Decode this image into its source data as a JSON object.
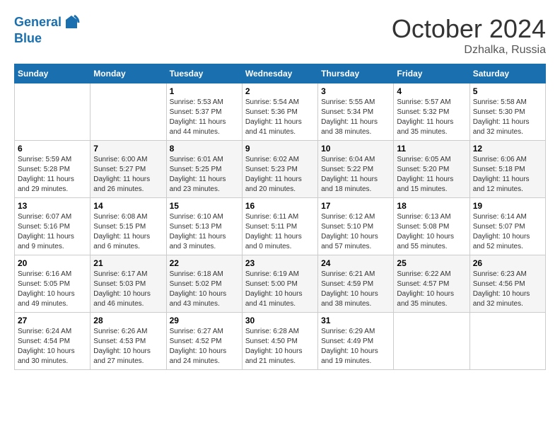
{
  "logo": {
    "line1": "General",
    "line2": "Blue"
  },
  "title": "October 2024",
  "location": "Dzhalka, Russia",
  "days_of_week": [
    "Sunday",
    "Monday",
    "Tuesday",
    "Wednesday",
    "Thursday",
    "Friday",
    "Saturday"
  ],
  "weeks": [
    [
      {
        "day": "",
        "sunrise": "",
        "sunset": "",
        "daylight": ""
      },
      {
        "day": "",
        "sunrise": "",
        "sunset": "",
        "daylight": ""
      },
      {
        "day": "1",
        "sunrise": "Sunrise: 5:53 AM",
        "sunset": "Sunset: 5:37 PM",
        "daylight": "Daylight: 11 hours and 44 minutes."
      },
      {
        "day": "2",
        "sunrise": "Sunrise: 5:54 AM",
        "sunset": "Sunset: 5:36 PM",
        "daylight": "Daylight: 11 hours and 41 minutes."
      },
      {
        "day": "3",
        "sunrise": "Sunrise: 5:55 AM",
        "sunset": "Sunset: 5:34 PM",
        "daylight": "Daylight: 11 hours and 38 minutes."
      },
      {
        "day": "4",
        "sunrise": "Sunrise: 5:57 AM",
        "sunset": "Sunset: 5:32 PM",
        "daylight": "Daylight: 11 hours and 35 minutes."
      },
      {
        "day": "5",
        "sunrise": "Sunrise: 5:58 AM",
        "sunset": "Sunset: 5:30 PM",
        "daylight": "Daylight: 11 hours and 32 minutes."
      }
    ],
    [
      {
        "day": "6",
        "sunrise": "Sunrise: 5:59 AM",
        "sunset": "Sunset: 5:28 PM",
        "daylight": "Daylight: 11 hours and 29 minutes."
      },
      {
        "day": "7",
        "sunrise": "Sunrise: 6:00 AM",
        "sunset": "Sunset: 5:27 PM",
        "daylight": "Daylight: 11 hours and 26 minutes."
      },
      {
        "day": "8",
        "sunrise": "Sunrise: 6:01 AM",
        "sunset": "Sunset: 5:25 PM",
        "daylight": "Daylight: 11 hours and 23 minutes."
      },
      {
        "day": "9",
        "sunrise": "Sunrise: 6:02 AM",
        "sunset": "Sunset: 5:23 PM",
        "daylight": "Daylight: 11 hours and 20 minutes."
      },
      {
        "day": "10",
        "sunrise": "Sunrise: 6:04 AM",
        "sunset": "Sunset: 5:22 PM",
        "daylight": "Daylight: 11 hours and 18 minutes."
      },
      {
        "day": "11",
        "sunrise": "Sunrise: 6:05 AM",
        "sunset": "Sunset: 5:20 PM",
        "daylight": "Daylight: 11 hours and 15 minutes."
      },
      {
        "day": "12",
        "sunrise": "Sunrise: 6:06 AM",
        "sunset": "Sunset: 5:18 PM",
        "daylight": "Daylight: 11 hours and 12 minutes."
      }
    ],
    [
      {
        "day": "13",
        "sunrise": "Sunrise: 6:07 AM",
        "sunset": "Sunset: 5:16 PM",
        "daylight": "Daylight: 11 hours and 9 minutes."
      },
      {
        "day": "14",
        "sunrise": "Sunrise: 6:08 AM",
        "sunset": "Sunset: 5:15 PM",
        "daylight": "Daylight: 11 hours and 6 minutes."
      },
      {
        "day": "15",
        "sunrise": "Sunrise: 6:10 AM",
        "sunset": "Sunset: 5:13 PM",
        "daylight": "Daylight: 11 hours and 3 minutes."
      },
      {
        "day": "16",
        "sunrise": "Sunrise: 6:11 AM",
        "sunset": "Sunset: 5:11 PM",
        "daylight": "Daylight: 11 hours and 0 minutes."
      },
      {
        "day": "17",
        "sunrise": "Sunrise: 6:12 AM",
        "sunset": "Sunset: 5:10 PM",
        "daylight": "Daylight: 10 hours and 57 minutes."
      },
      {
        "day": "18",
        "sunrise": "Sunrise: 6:13 AM",
        "sunset": "Sunset: 5:08 PM",
        "daylight": "Daylight: 10 hours and 55 minutes."
      },
      {
        "day": "19",
        "sunrise": "Sunrise: 6:14 AM",
        "sunset": "Sunset: 5:07 PM",
        "daylight": "Daylight: 10 hours and 52 minutes."
      }
    ],
    [
      {
        "day": "20",
        "sunrise": "Sunrise: 6:16 AM",
        "sunset": "Sunset: 5:05 PM",
        "daylight": "Daylight: 10 hours and 49 minutes."
      },
      {
        "day": "21",
        "sunrise": "Sunrise: 6:17 AM",
        "sunset": "Sunset: 5:03 PM",
        "daylight": "Daylight: 10 hours and 46 minutes."
      },
      {
        "day": "22",
        "sunrise": "Sunrise: 6:18 AM",
        "sunset": "Sunset: 5:02 PM",
        "daylight": "Daylight: 10 hours and 43 minutes."
      },
      {
        "day": "23",
        "sunrise": "Sunrise: 6:19 AM",
        "sunset": "Sunset: 5:00 PM",
        "daylight": "Daylight: 10 hours and 41 minutes."
      },
      {
        "day": "24",
        "sunrise": "Sunrise: 6:21 AM",
        "sunset": "Sunset: 4:59 PM",
        "daylight": "Daylight: 10 hours and 38 minutes."
      },
      {
        "day": "25",
        "sunrise": "Sunrise: 6:22 AM",
        "sunset": "Sunset: 4:57 PM",
        "daylight": "Daylight: 10 hours and 35 minutes."
      },
      {
        "day": "26",
        "sunrise": "Sunrise: 6:23 AM",
        "sunset": "Sunset: 4:56 PM",
        "daylight": "Daylight: 10 hours and 32 minutes."
      }
    ],
    [
      {
        "day": "27",
        "sunrise": "Sunrise: 6:24 AM",
        "sunset": "Sunset: 4:54 PM",
        "daylight": "Daylight: 10 hours and 30 minutes."
      },
      {
        "day": "28",
        "sunrise": "Sunrise: 6:26 AM",
        "sunset": "Sunset: 4:53 PM",
        "daylight": "Daylight: 10 hours and 27 minutes."
      },
      {
        "day": "29",
        "sunrise": "Sunrise: 6:27 AM",
        "sunset": "Sunset: 4:52 PM",
        "daylight": "Daylight: 10 hours and 24 minutes."
      },
      {
        "day": "30",
        "sunrise": "Sunrise: 6:28 AM",
        "sunset": "Sunset: 4:50 PM",
        "daylight": "Daylight: 10 hours and 21 minutes."
      },
      {
        "day": "31",
        "sunrise": "Sunrise: 6:29 AM",
        "sunset": "Sunset: 4:49 PM",
        "daylight": "Daylight: 10 hours and 19 minutes."
      },
      {
        "day": "",
        "sunrise": "",
        "sunset": "",
        "daylight": ""
      },
      {
        "day": "",
        "sunrise": "",
        "sunset": "",
        "daylight": ""
      }
    ]
  ]
}
